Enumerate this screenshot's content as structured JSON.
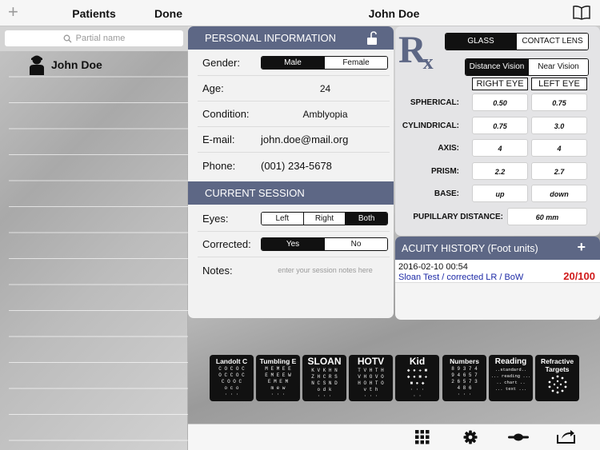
{
  "sidebar": {
    "title": "Patients",
    "add_icon": "plus-icon",
    "done_label": "Done",
    "search_placeholder": "Partial name",
    "patients": [
      {
        "name": "John Doe"
      }
    ]
  },
  "header": {
    "title": "John Doe",
    "book_icon": "book-icon"
  },
  "personal": {
    "heading": "PERSONAL INFORMATION",
    "gender_label": "Gender:",
    "gender_options": [
      "Male",
      "Female"
    ],
    "gender_selected": "Male",
    "age_label": "Age:",
    "age": "24",
    "condition_label": "Condition:",
    "condition": "Amblyopia",
    "email_label": "E-mail:",
    "email": "john.doe@mail.org",
    "phone_label": "Phone:",
    "phone": "(001) 234-5678"
  },
  "session": {
    "heading": "CURRENT SESSION",
    "eyes_label": "Eyes:",
    "eyes_options": [
      "Left",
      "Right",
      "Both"
    ],
    "eyes_selected": "Both",
    "corrected_label": "Corrected:",
    "corrected_options": [
      "Yes",
      "No"
    ],
    "corrected_selected": "Yes",
    "notes_label": "Notes:",
    "notes_placeholder": "enter your session notes here"
  },
  "rx": {
    "logo": "R",
    "logo_sub": "x",
    "lens_options": [
      "GLASS",
      "CONTACT LENS"
    ],
    "lens_selected": "GLASS",
    "vision_options": [
      "Distance Vision",
      "Near Vision"
    ],
    "vision_selected": "Distance Vision",
    "right_eye": "RIGHT EYE",
    "left_eye": "LEFT EYE",
    "rows": [
      {
        "label": "SPHERICAL:",
        "right": "0.50",
        "left": "0.75"
      },
      {
        "label": "CYLINDRICAL:",
        "right": "0.75",
        "left": "3.0"
      },
      {
        "label": "AXIS:",
        "right": "4",
        "left": "4"
      },
      {
        "label": "PRISM:",
        "right": "2.2",
        "left": "2.7"
      },
      {
        "label": "BASE:",
        "right": "up",
        "left": "down"
      }
    ],
    "pd_label": "PUPILLARY DISTANCE:",
    "pd_value": "60 mm"
  },
  "acuity": {
    "heading": "ACUITY HISTORY (Foot units)",
    "entries": [
      {
        "date": "2016-02-10 00:54",
        "test": "Sloan Test / corrected LR / BoW",
        "score": "20/100"
      }
    ]
  },
  "charts": [
    {
      "title": "Landolt C",
      "lines": [
        "C O C O C",
        "O C C O C",
        "C O O C",
        "o c o",
        "· · ·"
      ]
    },
    {
      "title": "Tumbling E",
      "lines": [
        "M E M E E",
        "E M E E W",
        "E M E M",
        "m e w",
        "· · ·"
      ]
    },
    {
      "title": "SLOAN",
      "lines": [
        "K V K H N",
        "Z H C R S",
        "N C S N D",
        "o d k",
        "· · ·"
      ]
    },
    {
      "title": "HOTV",
      "lines": [
        "T V H T H",
        "V H O V O",
        "H O H T O",
        "v t h",
        "· · ·"
      ]
    },
    {
      "title": "Kid",
      "lines": [
        "◆ ● ✚ ■",
        "◆ ● ■ ✚",
        "■ ● ◆",
        "· · ·",
        "· ·"
      ]
    },
    {
      "title": "Numbers",
      "lines": [
        "8 9 3 7 4",
        "9 4 6 5 7",
        "2 6 5 7 3",
        "4 8 6",
        "· · ·"
      ]
    },
    {
      "title": "Reading",
      "lines": [
        "..standard..",
        "... reading ...",
        ".. chart ..",
        "... text ...",
        ""
      ]
    },
    {
      "title": "Refractive Targets",
      "lines": [
        "",
        "",
        "",
        "",
        ""
      ]
    }
  ],
  "toolbar": {
    "icons": [
      "grid-icon",
      "gear-icon",
      "slider-icon",
      "share-icon"
    ]
  },
  "colors": {
    "accent": "#5d6785",
    "score": "#d01a1a",
    "link": "#1d2aa6"
  }
}
